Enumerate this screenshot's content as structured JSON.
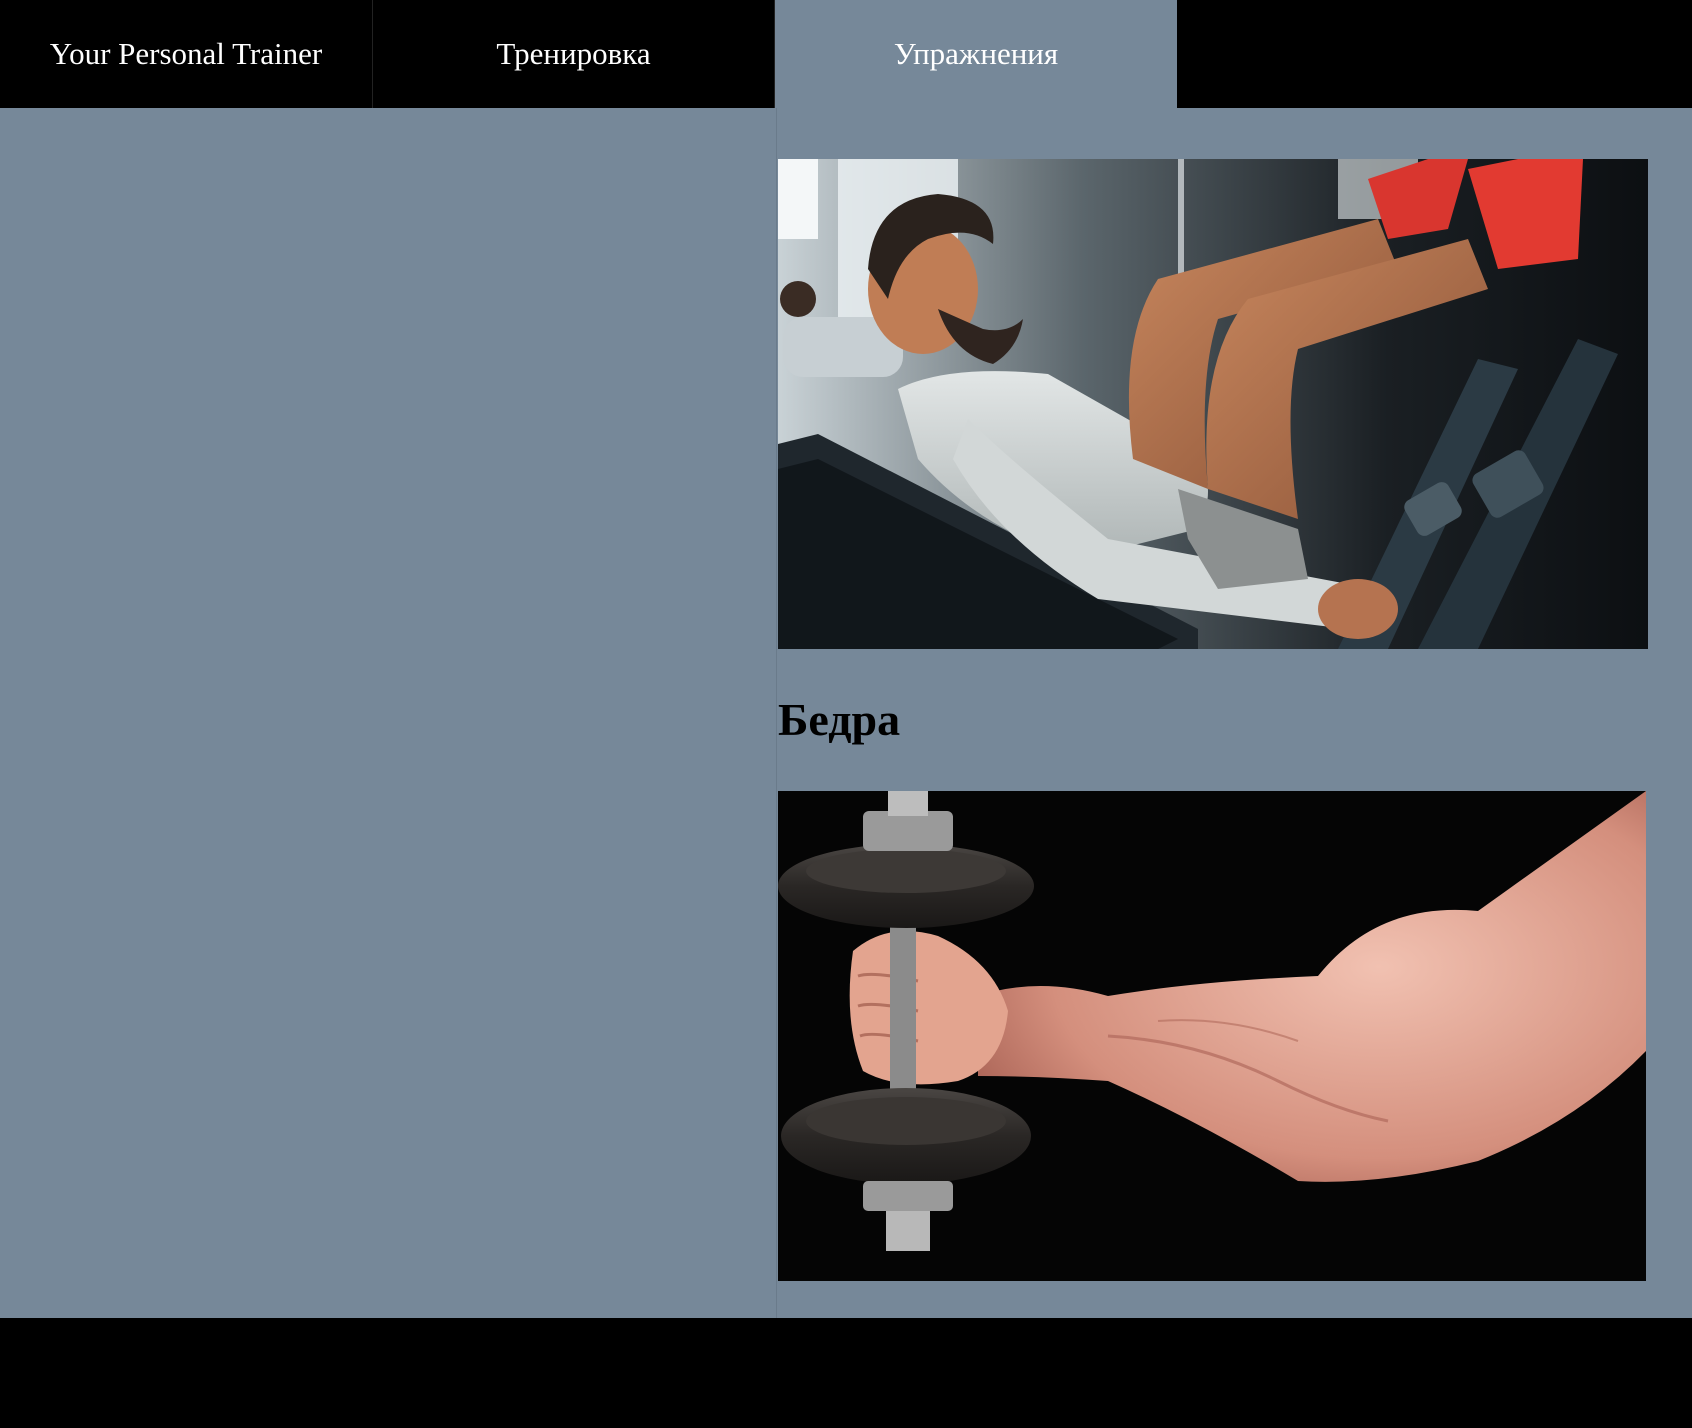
{
  "nav": {
    "brand": "Your Personal Trainer",
    "items": [
      {
        "label": "Тренировка",
        "active": false
      },
      {
        "label": "Упражнения",
        "active": true
      }
    ]
  },
  "content": {
    "section_title": "Бедра",
    "images": [
      {
        "subject": "man-on-leg-press-machine"
      },
      {
        "subject": "muscular-arm-holding-dumbbell"
      }
    ]
  },
  "colors": {
    "nav_background": "#000000",
    "page_background": "#768899",
    "active_tab": "#768899",
    "nav_text": "#ffffff"
  }
}
